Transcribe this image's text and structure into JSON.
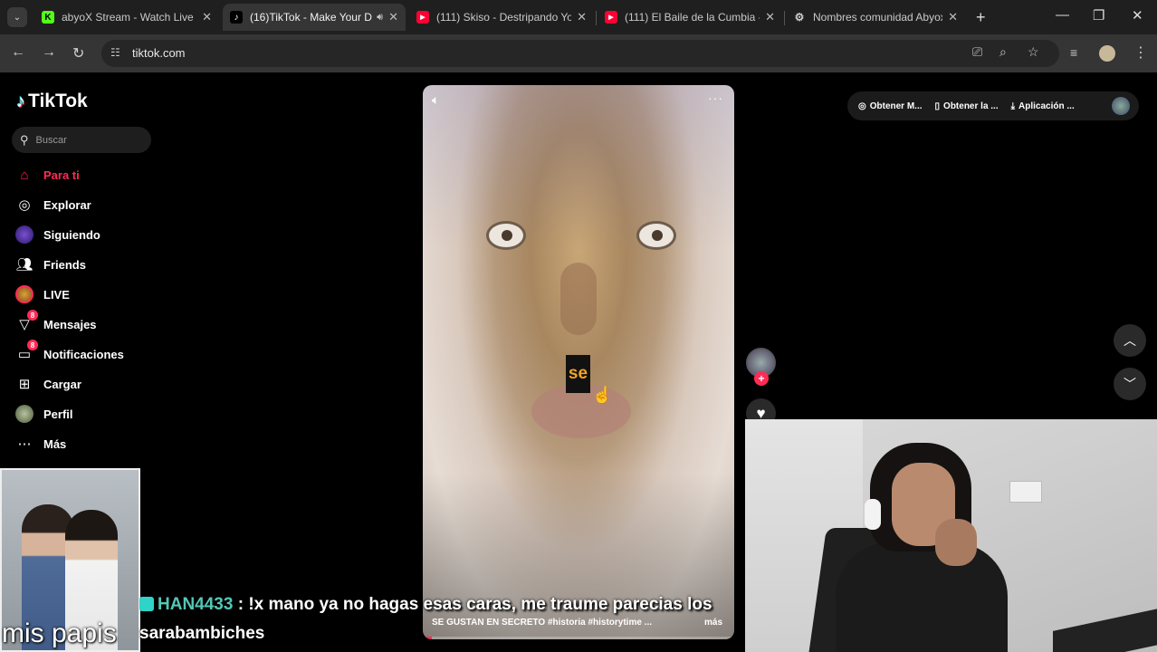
{
  "browser": {
    "tabs": [
      {
        "title": "abyoX Stream - Watch Live o",
        "favicon": "kick-icon",
        "color": "#53fc18"
      },
      {
        "title": "(16)TikTok - Make Your D",
        "favicon": "tiktok-icon",
        "color": "#ffffff",
        "active": true
      },
      {
        "title": "(111) Skiso - Destripando Yo",
        "favicon": "youtube-icon",
        "color": "#ff0033"
      },
      {
        "title": "(111) El Baile de la Cumbia -",
        "favicon": "youtube-icon",
        "color": "#ff0033"
      },
      {
        "title": "Nombres comunidad Abyox",
        "favicon": "chatgpt-icon",
        "color": "#cccccc"
      }
    ],
    "url": "tiktok.com"
  },
  "tiktok": {
    "logo": "TikTok",
    "search_placeholder": "Buscar",
    "nav": [
      {
        "label": "Para ti",
        "icon": "home-icon",
        "active": true
      },
      {
        "label": "Explorar",
        "icon": "compass-icon"
      },
      {
        "label": "Siguiendo",
        "icon": "following-avatar-icon"
      },
      {
        "label": "Friends",
        "icon": "friends-icon"
      },
      {
        "label": "LIVE",
        "icon": "live-icon"
      },
      {
        "label": "Mensajes",
        "icon": "message-icon",
        "badge": "8"
      },
      {
        "label": "Notificaciones",
        "icon": "notification-icon",
        "badge": "8"
      },
      {
        "label": "Cargar",
        "icon": "upload-icon"
      },
      {
        "label": "Perfil",
        "icon": "profile-avatar-icon"
      },
      {
        "label": "Más",
        "icon": "more-icon"
      }
    ],
    "top_buttons": [
      "Obtener M...",
      "Obtener la ...",
      "Aplicación ..."
    ],
    "video": {
      "overlay_text": "se",
      "caption": "SE GUSTAN EN SECRETO #historia #historytime ...",
      "more": "más"
    }
  },
  "stream": {
    "cam_label": "mis papis",
    "chat_user": "HAN4433",
    "chat_message": ": !x mano ya no hagas esas caras, me traume parecias los",
    "chat_message_cont": "sarabambiches"
  }
}
